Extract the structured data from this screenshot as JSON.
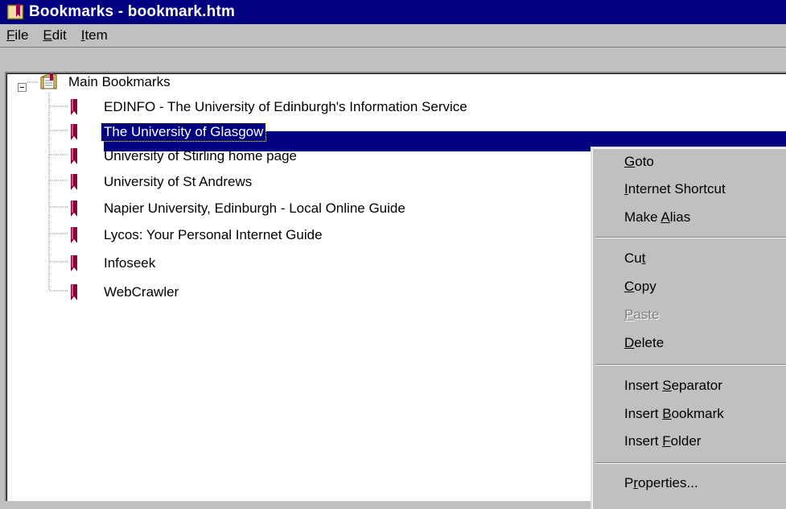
{
  "window": {
    "title": "Bookmarks - bookmark.htm",
    "title_icon": "bookmark-book-icon"
  },
  "menubar": {
    "items": [
      {
        "accel": "F",
        "rest": "ile"
      },
      {
        "accel": "E",
        "rest": "dit"
      },
      {
        "accel": "I",
        "rest": "tem"
      }
    ]
  },
  "tree": {
    "root": {
      "label": "Main Bookmarks",
      "icon": "folder-bookmarks-icon",
      "expanded": true
    },
    "items": [
      {
        "label": "EDINFO - The University of Edinburgh's Information Service",
        "icon": "bookmark-icon"
      },
      {
        "label": "The University of Glasgow",
        "icon": "bookmark-icon",
        "selected": true
      },
      {
        "label": "University of Stirling home page",
        "icon": "bookmark-icon"
      },
      {
        "label": "University of St Andrews",
        "icon": "bookmark-icon"
      },
      {
        "label": "Napier University, Edinburgh - Local Online Guide",
        "icon": "bookmark-icon"
      },
      {
        "label": "Lycos: Your Personal Internet Guide",
        "icon": "bookmark-icon"
      },
      {
        "label": "Infoseek",
        "icon": "bookmark-icon"
      },
      {
        "label": "WebCrawler",
        "icon": "bookmark-icon"
      }
    ]
  },
  "context_menu": {
    "goto": {
      "accel": "G",
      "rest": "oto"
    },
    "internet_shortcut": {
      "accel": "I",
      "rest": "nternet Shortcut"
    },
    "make_alias": {
      "pre": "Make ",
      "accel": "A",
      "rest": "lias"
    },
    "cut": {
      "pre": "Cu",
      "accel": "t"
    },
    "copy": {
      "accel": "C",
      "rest": "opy"
    },
    "paste": {
      "accel": "P",
      "rest": "aste",
      "disabled": true
    },
    "delete": {
      "accel": "D",
      "rest": "elete"
    },
    "insert_separator": {
      "pre": "Insert ",
      "accel": "S",
      "rest": "eparator"
    },
    "insert_bookmark": {
      "pre": "Insert ",
      "accel": "B",
      "rest": "ookmark"
    },
    "insert_folder": {
      "pre": "Insert ",
      "accel": "F",
      "rest": "older"
    },
    "properties": {
      "pre": "P",
      "accel": "r",
      "rest": "operties..."
    }
  },
  "colors": {
    "titlebar": "#000080",
    "selection": "#000080",
    "window_face": "#c0c0c0",
    "bookmark_icon": "#8b0036"
  }
}
